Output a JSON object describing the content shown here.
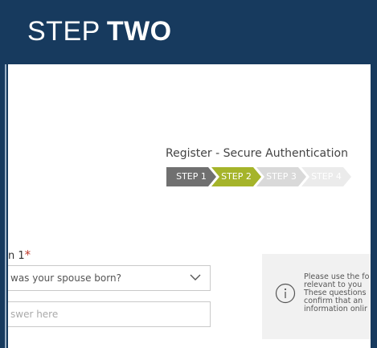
{
  "header": {
    "title_regular": "STEP",
    "title_bold": "TWO"
  },
  "registration": {
    "title": "Register - Secure Authentication",
    "steps": [
      "STEP 1",
      "STEP 2",
      "STEP 3",
      "STEP 4"
    ]
  },
  "form": {
    "question_label": "n 1",
    "required_mark": "*",
    "select_value": "was your spouse born?",
    "answer_placeholder": "swer here"
  },
  "info": {
    "lines": [
      "Please use the fo",
      "relevant to you",
      "These questions",
      "confirm that an",
      "information onlir"
    ]
  },
  "colors": {
    "header_bg": "#173a5e",
    "step_active": "#a5b42a",
    "step_done": "#707070",
    "required": "#c0392b"
  }
}
